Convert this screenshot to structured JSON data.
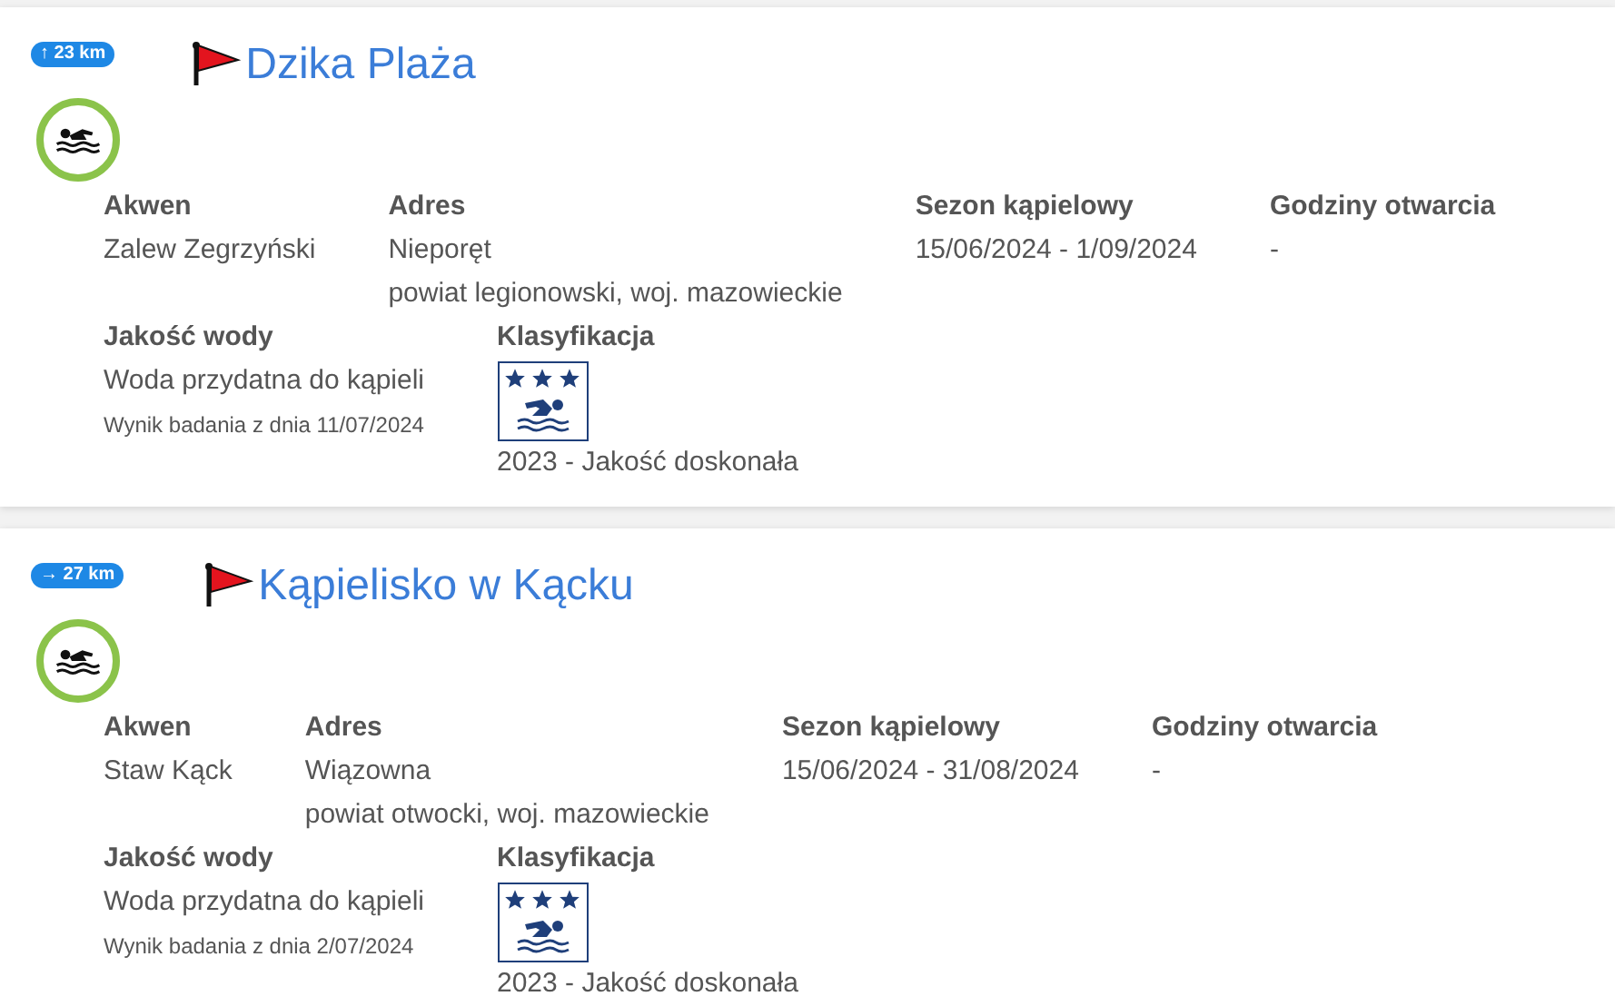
{
  "beaches": [
    {
      "distance": "↑ 23 km",
      "name": "Dzika Plaża",
      "fields": [
        {
          "label": "Akwen",
          "lines": [
            "Zalew Zegrzyński"
          ]
        },
        {
          "label": "Adres",
          "lines": [
            "Nieporęt",
            "powiat legionowski, woj. mazowieckie"
          ]
        },
        {
          "label": "Sezon kąpielowy",
          "lines": [
            "15/06/2024 - 1/09/2024"
          ]
        },
        {
          "label": "Godziny otwarcia",
          "lines": [
            "-"
          ]
        }
      ],
      "water_quality": {
        "label": "Jakość wody",
        "value": "Woda przydatna do kąpieli",
        "note": "Wynik badania z dnia 11/07/2024"
      },
      "classification": {
        "label": "Klasyfikacja",
        "stars": 3,
        "text": "2023 - Jakość doskonała"
      }
    },
    {
      "distance": "→ 27 km",
      "name": "Kąpielisko w Kącku",
      "fields": [
        {
          "label": "Akwen",
          "lines": [
            "Staw Kąck"
          ]
        },
        {
          "label": "Adres",
          "lines": [
            "Wiązowna",
            "powiat otwocki, woj. mazowieckie"
          ]
        },
        {
          "label": "Sezon kąpielowy",
          "lines": [
            "15/06/2024 - 31/08/2024"
          ]
        },
        {
          "label": "Godziny otwarcia",
          "lines": [
            "-"
          ]
        }
      ],
      "water_quality": {
        "label": "Jakość wody",
        "value": "Woda przydatna do kąpieli",
        "note": "Wynik badania z dnia 2/07/2024"
      },
      "classification": {
        "label": "Klasyfikacja",
        "stars": 3,
        "text": "2023 - Jakość doskonała"
      }
    }
  ]
}
